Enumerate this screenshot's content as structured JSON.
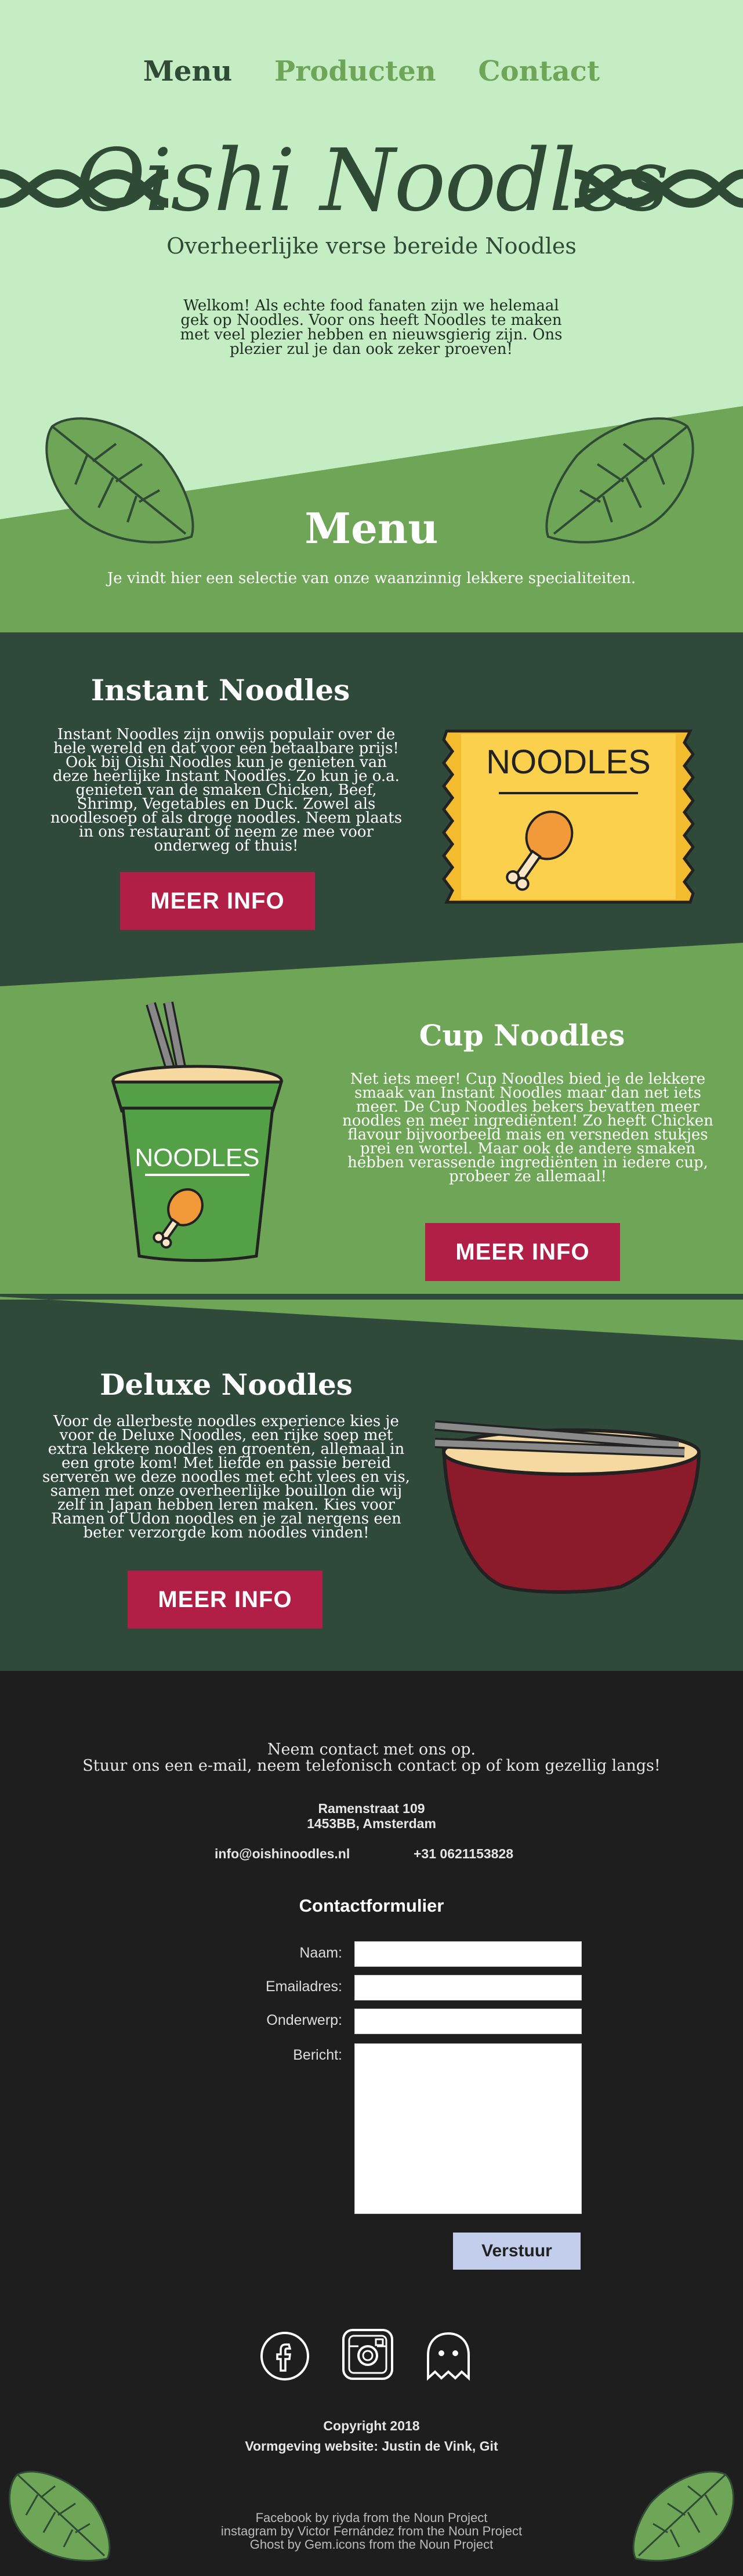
{
  "nav": {
    "items": [
      "Menu",
      "Producten",
      "Contact"
    ]
  },
  "hero": {
    "logo": "Oishi Noodles",
    "tagline": "Overheerlijke verse bereide Noodles",
    "welcome": "Welkom! Als echte food fanaten zijn we helemaal gek op Noodles. Voor ons heeft Noodles te maken met veel plezier hebben en nieuwsgierig zijn. Ons plezier zul je dan ook zeker proeven!"
  },
  "menu": {
    "title": "Menu",
    "subtitle": "Je vindt hier een selectie van onze waanzinnig lekkere specialiteiten."
  },
  "products": [
    {
      "title": "Instant Noodles",
      "text": "Instant Noodles zijn onwijs populair over de hele wereld en dat voor een betaalbare prijs! Ook bij Oishi Noodles kun je genieten van deze heerlijke Instant Noodles. Zo kun je o.a. genieten van de smaken Chicken, Beef, Shrimp, Vegetables en Duck. Zowel als noodlesoep of als droge noodles. Neem plaats in ons restaurant of neem ze mee voor onderweg of thuis!",
      "button": "MEER INFO",
      "image_label": "NOODLES"
    },
    {
      "title": "Cup Noodles",
      "text": "Net iets meer! Cup Noodles bied je de lekkere smaak van Instant Noodles maar dan net iets meer. De Cup Noodles bekers bevatten meer noodles en meer ingrediënten! Zo heeft Chicken flavour bijvoorbeeld mais en versneden stukjes prei en wortel. Maar ook de andere smaken hebben verassende ingrediënten in iedere cup, probeer ze allemaal!",
      "button": "MEER INFO",
      "image_label": "NOODLES"
    },
    {
      "title": "Deluxe Noodles",
      "text": "Voor de allerbeste noodles experience kies je voor de Deluxe Noodles, een rijke soep met extra lekkere noodles en groenten, allemaal in een grote kom! Met liefde en passie bereid serveren we deze noodles met echt vlees en vis, samen met onze overheerlijke bouillon die wij zelf in Japan hebben leren maken. Kies voor Ramen of Udon noodles en je zal nergens een beter verzorgde kom noodles vinden!",
      "button": "MEER INFO"
    }
  ],
  "footer": {
    "intro1": "Neem contact met ons op.",
    "intro2": "Stuur ons een e-mail, neem telefonisch contact op of kom gezellig langs!",
    "street": "Ramenstraat 109",
    "city": "1453BB, Amsterdam",
    "email": "info@oishinoodles.nl",
    "phone": "+31 0621153828",
    "form_title": "Contactformulier",
    "labels": {
      "name": "Naam:",
      "email": "Emailadres:",
      "subject": "Onderwerp:",
      "message": "Bericht:"
    },
    "submit": "Verstuur",
    "copyright": "Copyright 2018",
    "credits": "Vormgeving website: Justin de Vink, Git",
    "attrib1": "Facebook by riyda from the Noun Project",
    "attrib2": "instagram by Victor Fernández from the Noun Project",
    "attrib3": "Ghost by Gem.icons from the Noun Project"
  },
  "colors": {
    "light_green": "#c5edc4",
    "mid_green": "#6ea556",
    "dark_green": "#2f4a3a",
    "footer": "#1e1e1e",
    "button": "#b11f46",
    "nav_active": "#2f4a35",
    "nav_inactive": "#6ea556"
  }
}
